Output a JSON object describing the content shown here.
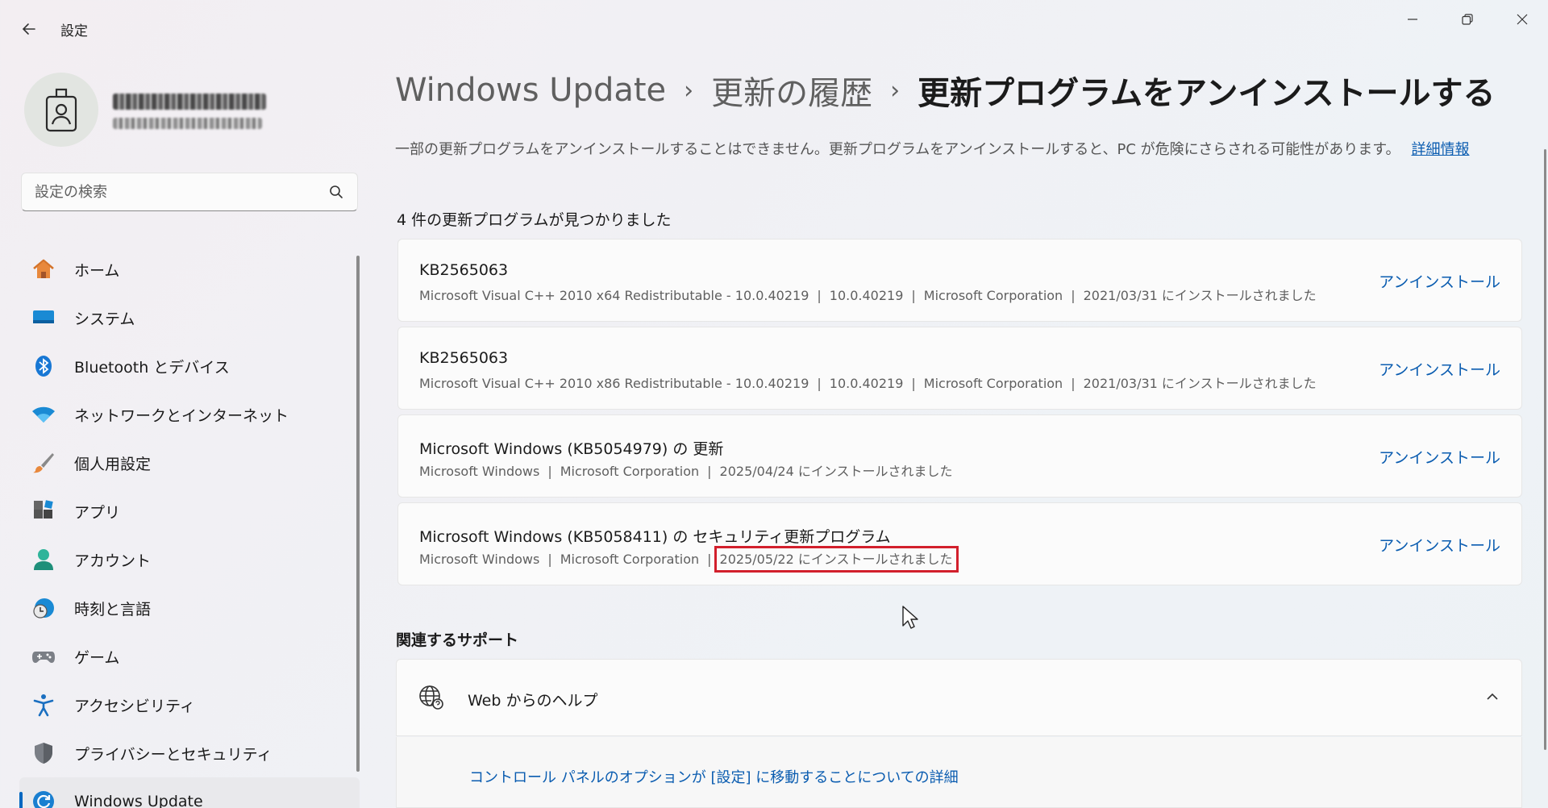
{
  "app": {
    "title": "設定"
  },
  "window_controls": {
    "minimize": "minimize-icon",
    "maximize": "restore-icon",
    "close": "close-icon"
  },
  "search": {
    "placeholder": "設定の検索"
  },
  "sidebar": {
    "items": [
      {
        "label": "ホーム",
        "icon": "home-icon"
      },
      {
        "label": "システム",
        "icon": "system-icon"
      },
      {
        "label": "Bluetooth とデバイス",
        "icon": "bluetooth-icon"
      },
      {
        "label": "ネットワークとインターネット",
        "icon": "wifi-icon"
      },
      {
        "label": "個人用設定",
        "icon": "brush-icon"
      },
      {
        "label": "アプリ",
        "icon": "apps-icon"
      },
      {
        "label": "アカウント",
        "icon": "account-icon"
      },
      {
        "label": "時刻と言語",
        "icon": "time-language-icon"
      },
      {
        "label": "ゲーム",
        "icon": "gamepad-icon"
      },
      {
        "label": "アクセシビリティ",
        "icon": "accessibility-icon"
      },
      {
        "label": "プライバシーとセキュリティ",
        "icon": "shield-icon"
      },
      {
        "label": "Windows Update",
        "icon": "windows-update-icon",
        "active": true
      }
    ]
  },
  "breadcrumb": {
    "root": "Windows Update",
    "mid": "更新の履歴",
    "current": "更新プログラムをアンインストールする",
    "separator": "›"
  },
  "notice": {
    "text": "一部の更新プログラムをアンインストールすることはできません。更新プログラムをアンインストールすると、PC が危険にさらされる可能性があります。",
    "link": "詳細情報"
  },
  "updates": {
    "count_text": "4 件の更新プログラムが見つかりました",
    "action_label": "アンインストール",
    "items": [
      {
        "title": "KB2565063",
        "parts": [
          "Microsoft Visual C++ 2010  x64 Redistributable - 10.0.40219",
          "10.0.40219",
          "Microsoft Corporation",
          "2021/03/31 にインストールされました"
        ]
      },
      {
        "title": "KB2565063",
        "parts": [
          "Microsoft Visual C++ 2010  x86 Redistributable - 10.0.40219",
          "10.0.40219",
          "Microsoft Corporation",
          "2021/03/31 にインストールされました"
        ]
      },
      {
        "title": "Microsoft Windows (KB5054979) の 更新",
        "parts": [
          "Microsoft Windows",
          "Microsoft Corporation",
          "2025/04/24 にインストールされました"
        ]
      },
      {
        "title": "Microsoft Windows (KB5058411) の セキュリティ更新プログラム",
        "parts": [
          "Microsoft Windows",
          "Microsoft Corporation",
          "2025/05/22 にインストールされました"
        ],
        "highlight_last": true
      }
    ]
  },
  "related": {
    "title": "関連するサポート",
    "panel_label": "Web からのヘルプ",
    "link": "コントロール パネルのオプションが [設定] に移動することについての詳細"
  },
  "colors": {
    "accent": "#0067c0",
    "link": "#0a5cb0",
    "highlight": "#d21f2c"
  }
}
